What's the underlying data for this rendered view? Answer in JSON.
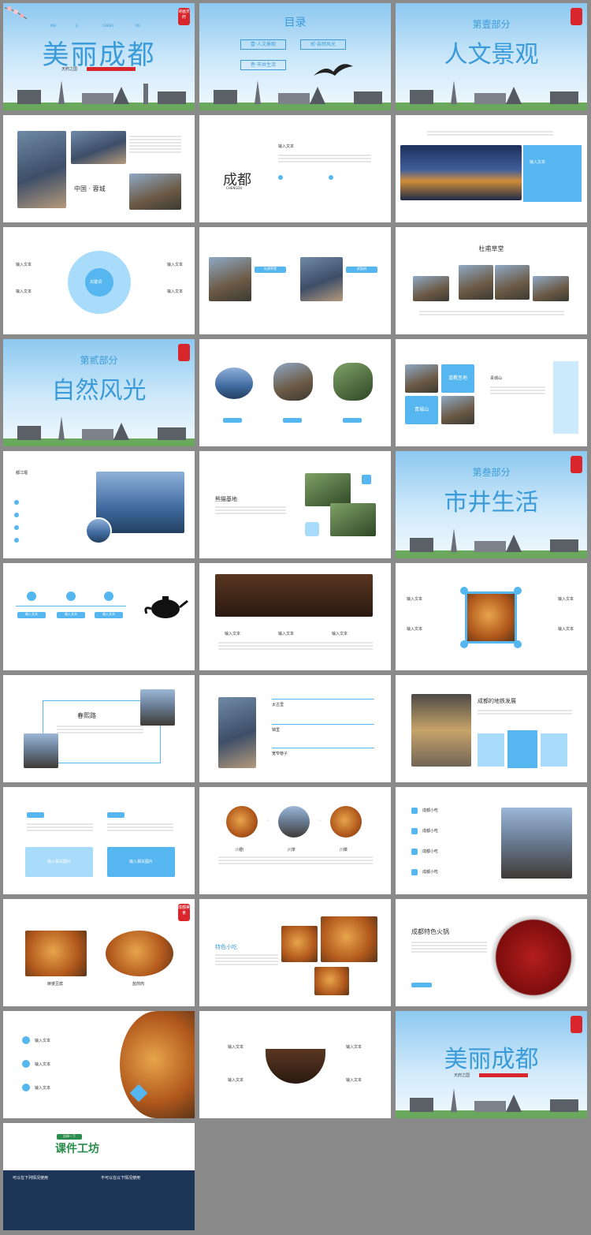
{
  "cover": {
    "main_title": "美丽成都",
    "letters": [
      "MEI",
      "LI",
      "CHENG",
      "DU"
    ],
    "subtitle": "天府之国",
    "stamp": "诗画天府"
  },
  "toc": {
    "title": "目录",
    "items": [
      "壹·人文景观",
      "贰·自然风光",
      "叁·市井生活"
    ]
  },
  "part1": {
    "label": "第壹部分",
    "title": "人文景观"
  },
  "part2": {
    "label": "第贰部分",
    "title": "自然风光"
  },
  "part3": {
    "label": "第叁部分",
    "title": "市井生活"
  },
  "s4": {
    "caption": "中国 · 蓉城"
  },
  "s5": {
    "logo": "成都",
    "logo_sub": "CHENGDU",
    "heading": "输入文本"
  },
  "s6": {
    "heading": "输入文本"
  },
  "s7": {
    "center": "关键词",
    "labels": [
      "输入文本",
      "输入文本",
      "输入文本",
      "输入文本"
    ]
  },
  "s8": {
    "tags": [
      "杜甫草堂",
      "武侯祠"
    ]
  },
  "s9": {
    "title": "杜甫草堂"
  },
  "s12": {
    "tags": [
      "道教圣地",
      "青城山"
    ],
    "title": "青城山"
  },
  "s13": {
    "title": "都江堰"
  },
  "s14": {
    "title": "熊猫基地"
  },
  "s16": {
    "labels": [
      "输入文本",
      "输入文本",
      "输入文本"
    ]
  },
  "s17": {
    "labels": [
      "输入文本",
      "输入文本",
      "输入文本"
    ]
  },
  "s18": {
    "labels": [
      "输入文本",
      "输入文本",
      "输入文本",
      "输入文本"
    ]
  },
  "s19": {
    "title": "春熙路"
  },
  "s20": {
    "items": [
      "太古里",
      "锦里",
      "宽窄巷子"
    ]
  },
  "s21": {
    "title": "成都的地铁发展"
  },
  "s22": {
    "buttons": [
      "输入相关图片",
      "输入相关图片"
    ]
  },
  "s23": {
    "labels": [
      "川剧",
      "川茶",
      "川菜"
    ]
  },
  "s24": {
    "items": [
      "成都小吃",
      "成都小吃",
      "成都小吃",
      "成都小吃"
    ]
  },
  "s25": {
    "captions": [
      "麻婆豆腐",
      "盐煎肉"
    ],
    "stamp": "成都美食"
  },
  "s26": {
    "title": "特色小吃"
  },
  "s27": {
    "title": "成都特色火锅"
  },
  "s28": {
    "labels": [
      "输入文本",
      "输入文本",
      "输入文本"
    ]
  },
  "s29": {
    "labels": [
      "输入文本",
      "输入文本",
      "输入文本",
      "输入文本"
    ]
  },
  "ending": {
    "main_title": "美丽成都",
    "subtitle": "天府之国"
  },
  "ad": {
    "badge": "自体一下",
    "brand": "课件工坊",
    "left_title": "可以在下列情况使用",
    "right_title": "不可以在以下情况使用"
  },
  "colors": {
    "accent": "#56b6ef",
    "title_blue": "#3b9bd8",
    "stamp_red": "#d9262c",
    "ad_navy": "#1d3557"
  }
}
